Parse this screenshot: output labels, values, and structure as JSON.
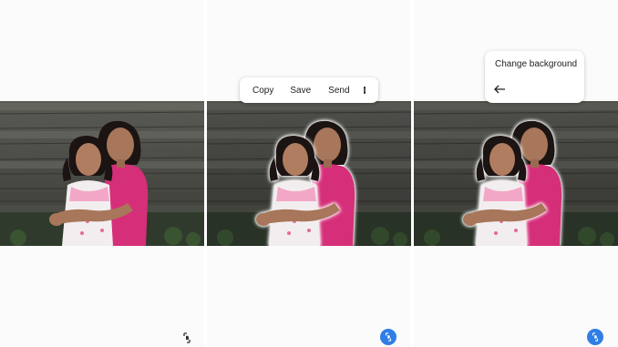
{
  "panels": [
    {
      "id": "original",
      "fab_icon": "subject-select-icon",
      "fab_active": false
    },
    {
      "id": "subject-selected",
      "fab_icon": "subject-select-icon",
      "fab_active": true
    },
    {
      "id": "change-background",
      "fab_icon": "subject-select-icon",
      "fab_active": true
    }
  ],
  "context_menu": {
    "copy": "Copy",
    "save": "Save",
    "send": "Send",
    "more_icon": "more-vert-icon"
  },
  "background_popup": {
    "label": "Change background",
    "back_icon": "arrow-back-icon"
  },
  "colors": {
    "fab_active": "#2f7ee6",
    "panel_background": "#fbfbfb"
  }
}
